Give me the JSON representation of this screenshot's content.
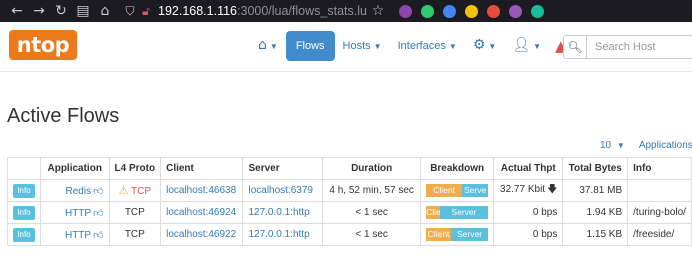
{
  "browser": {
    "url_host": "192.168.1.116",
    "url_path": ":3000/lua/flows_stats.lu",
    "extensions": [
      "#8e44ad",
      "#2ecc71",
      "#4285f4",
      "#f1c40f",
      "#e74c3c",
      "#9b59b6",
      "#1abc9c"
    ]
  },
  "navbar": {
    "logo": "ntop",
    "flows": "Flows",
    "hosts": "Hosts",
    "interfaces": "Interfaces",
    "search_placeholder": "Search Host"
  },
  "page": {
    "title": "Active Flows"
  },
  "toolbar": {
    "page_size": "10",
    "applications": "Applications"
  },
  "table": {
    "headers": [
      "",
      "Application",
      "L4 Proto",
      "Client",
      "Server",
      "Duration",
      "Breakdown",
      "Actual Thpt",
      "Total Bytes",
      "Info"
    ],
    "rows": [
      {
        "info": "Info",
        "app": "Redis",
        "proto": "TCP",
        "client": "localhost:46638",
        "server": "localhost:6379",
        "duration": "4 h, 52 min, 57 sec",
        "client_pct": 58,
        "server_pct": 42,
        "client_label": "Client",
        "server_label": "Serve",
        "thpt": "32.77 Kbit",
        "bytes": "37.81 MB",
        "info_text": ""
      },
      {
        "info": "Info",
        "app": "HTTP",
        "proto": "TCP",
        "client": "localhost:46924",
        "server": "127.0.0.1:http",
        "duration": "< 1 sec",
        "client_pct": 22,
        "server_pct": 78,
        "client_label": "Clie",
        "server_label": "Server",
        "thpt": "0 bps",
        "bytes": "1.94 KB",
        "info_text": "/turing-bolo/"
      },
      {
        "info": "Info",
        "app": "HTTP",
        "proto": "TCP",
        "client": "localhost:46922",
        "server": "127.0.0.1:http",
        "duration": "< 1 sec",
        "client_pct": 40,
        "server_pct": 60,
        "client_label": "Client",
        "server_label": "Server",
        "thpt": "0 bps",
        "bytes": "1.15 KB",
        "info_text": "/freeside/"
      }
    ]
  }
}
